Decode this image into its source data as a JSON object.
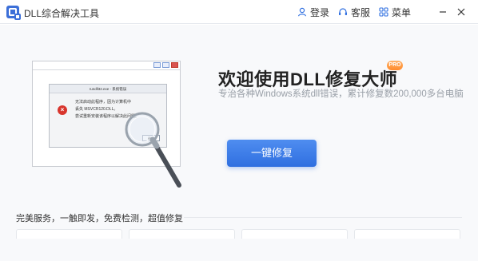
{
  "window": {
    "title": "DLL综合解决工具"
  },
  "titlebar": {
    "login_label": "登录",
    "service_label": "客服",
    "menu_label": "菜单"
  },
  "hero": {
    "headline": "欢迎使用DLL修复大师",
    "badge": "PRO",
    "subtitle": "专治各种Windows系统dll错误，累计修复数200,000多台电脑",
    "repair_button": "一键修复"
  },
  "illustration": {
    "dialog_title": "rundll32.exe - 系统错误",
    "message_lines": [
      "无法启动此程序，因为计算机中",
      "丢失 MSVCR120.DLL。",
      "尝试重新安装该程序以解决此问题。"
    ],
    "ok_label": "确定"
  },
  "footer": {
    "features": "完美服务，一触即发，免费检测，超值修复"
  },
  "colors": {
    "accent": "#2f6fe0",
    "badge": "#ff8a2a",
    "error": "#d8352d"
  }
}
